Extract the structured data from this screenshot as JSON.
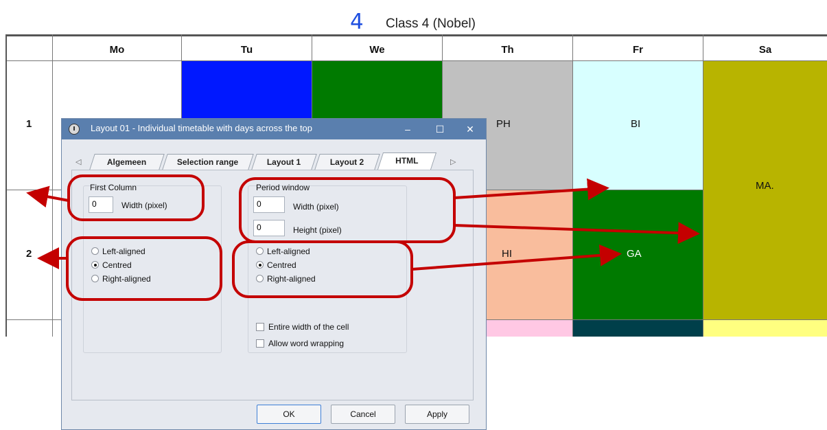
{
  "heading": {
    "number": "4",
    "name": "Class 4 (Nobel)"
  },
  "timetable": {
    "days": [
      "Mo",
      "Tu",
      "We",
      "Th",
      "Fr",
      "Sa"
    ],
    "periods": [
      "1",
      "2"
    ],
    "lessons": [
      {
        "day": "Th",
        "period": "1",
        "label": "PH",
        "color": "#c0c0c0"
      },
      {
        "day": "Fr",
        "period": "1",
        "label": "BI",
        "color": "#d8ffff"
      },
      {
        "day": "Sa",
        "period": "1-2",
        "label": "MA.",
        "color": "#b8b400"
      },
      {
        "day": "Th",
        "period": "2",
        "label": "HI",
        "color": "#f9bd9d"
      },
      {
        "day": "Fr",
        "period": "2",
        "label": "GA",
        "color": "#007a00"
      },
      {
        "day": "Tu",
        "period": "1",
        "label": "",
        "color": "#0018ff"
      },
      {
        "day": "We",
        "period": "1",
        "label": "",
        "color": "#007a00"
      }
    ],
    "row3_colors": {
      "Th": "#ffc8e4",
      "Fr": "#003f4a",
      "Sa": "#ffff80"
    }
  },
  "dialog": {
    "title": "Layout 01 - Individual timetable with days across the top",
    "window_buttons": {
      "minimize": "–",
      "maximize": "☐",
      "close": "✕"
    },
    "tabs": [
      {
        "label": "Algemeen",
        "active": false
      },
      {
        "label": "Selection range",
        "active": false
      },
      {
        "label": "Layout 1",
        "active": false
      },
      {
        "label": "Layout 2",
        "active": false
      },
      {
        "label": "HTML",
        "active": true
      }
    ],
    "tab_scroll": {
      "left": "◁",
      "right": "▷"
    },
    "first_column": {
      "label": "First Column",
      "width_value": "0",
      "width_label": "Width (pixel)",
      "alignment": [
        {
          "label": "Left-aligned",
          "checked": false
        },
        {
          "label": "Centred",
          "checked": true
        },
        {
          "label": "Right-aligned",
          "checked": false
        }
      ]
    },
    "period_window": {
      "label": "Period window",
      "width_value": "0",
      "width_label": "Width (pixel)",
      "height_value": "0",
      "height_label": "Height (pixel)",
      "alignment": [
        {
          "label": "Left-aligned",
          "checked": false
        },
        {
          "label": "Centred",
          "checked": true
        },
        {
          "label": "Right-aligned",
          "checked": false
        }
      ],
      "entire_width_label": "Entire width of the cell",
      "entire_width_checked": false,
      "word_wrap_label": "Allow word wrapping",
      "word_wrap_checked": false
    },
    "buttons": {
      "ok": "OK",
      "cancel": "Cancel",
      "apply": "Apply"
    }
  },
  "annotation_color": "#c40000"
}
